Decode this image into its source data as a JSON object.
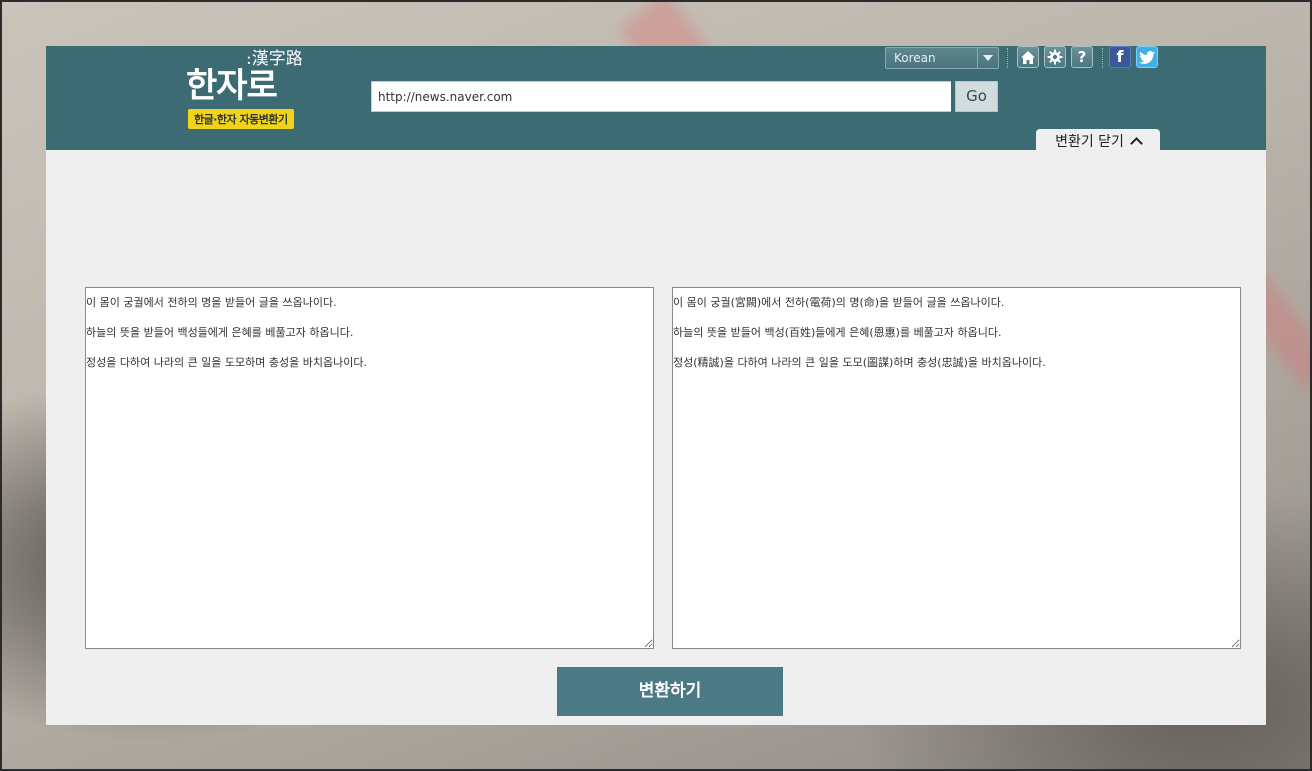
{
  "logo": {
    "title": "한자로",
    "hanja": ":漢字路",
    "badge": "한글·한자 자동변환기"
  },
  "header": {
    "url_value": "http://news.naver.com",
    "go_label": "Go",
    "language_selected": "Korean",
    "icons": [
      "home-icon",
      "gear-icon",
      "help-icon",
      "facebook-icon",
      "twitter-icon"
    ],
    "help_glyph": "?",
    "facebook_glyph": "f",
    "close_label": "변환기 닫기"
  },
  "converter": {
    "input_text": "이 몸이 궁궐에서 전하의 명을 받들어 글을 쓰옵나이다.\n하늘의 뜻을 받들어 백성들에게 은혜를 베풀고자 하옵니다.\n정성을 다하여 나라의 큰 일을 도모하며 충성을 바치옵나이다.",
    "output_text": "이 몸이 궁궐(宮闕)에서 전하(電荷)의 명(命)을 받들어 글을 쓰옵나이다.\n하늘의 뜻을 받들어 백성(百姓)들에게 은혜(恩惠)를 베풀고자 하옵니다.\n정성(精誠)을 다하여 나라의 큰 일을 도모(圖謀)하며 충성(忠誠)을 바치옵나이다.",
    "convert_label": "변환하기"
  },
  "colors": {
    "header_bg": "#3d6b74",
    "badge_bg": "#f3d31a",
    "button_bg": "#4b7a85",
    "panel_bg": "#efefef",
    "facebook": "#3b5998",
    "twitter": "#3fb1e6"
  }
}
